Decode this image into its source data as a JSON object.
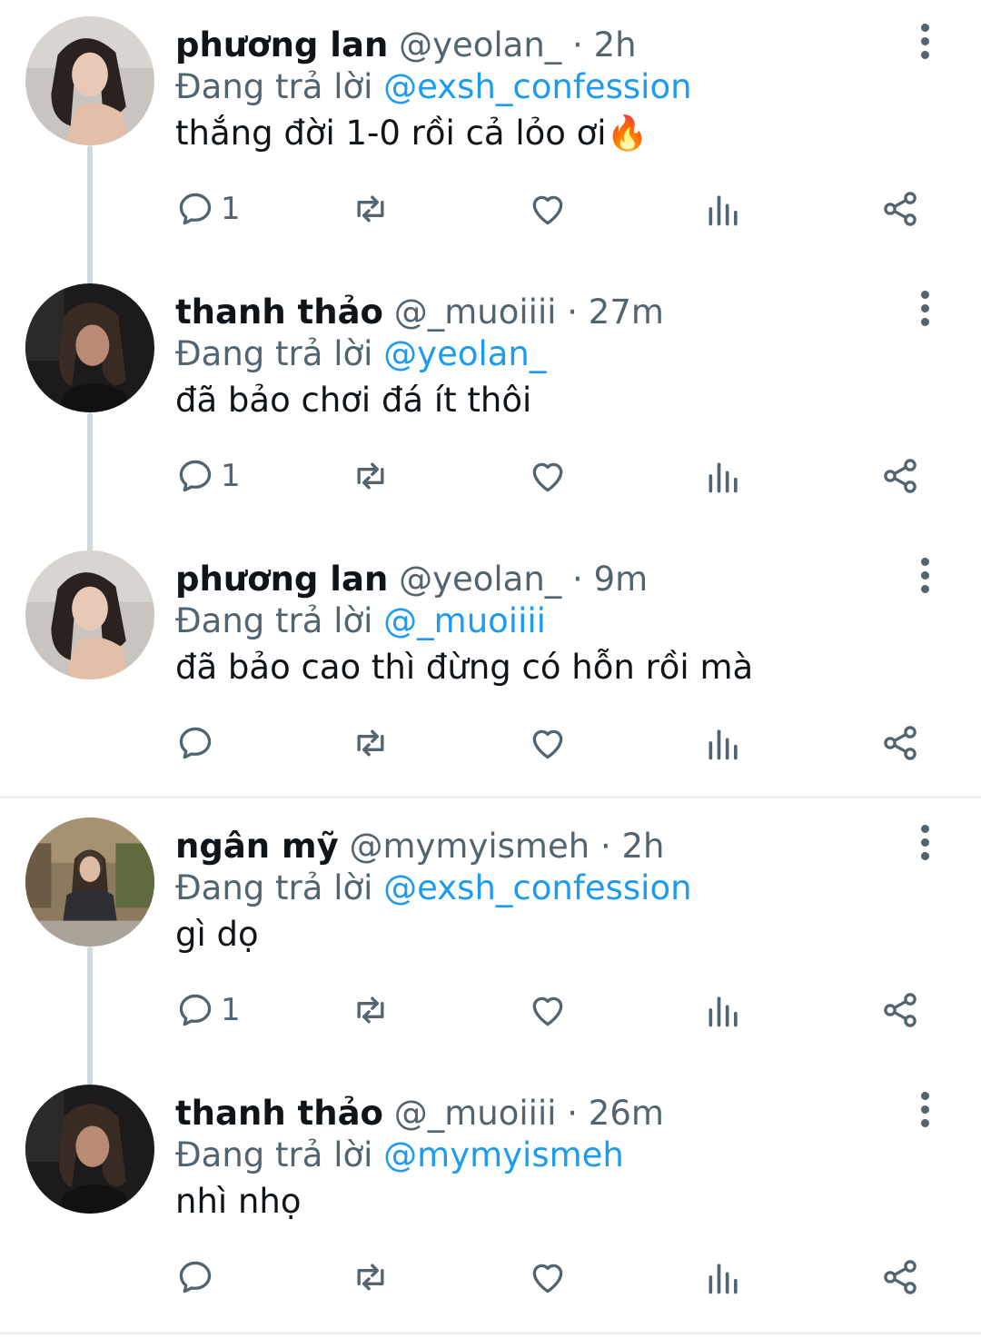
{
  "tweets": [
    {
      "name": "phương lan",
      "handle": "@yeolan_",
      "dot": "·",
      "time": "2h",
      "reply_prefix": "Đang trả lời",
      "reply_to": "@exsh_confession",
      "text": "thắng đời 1-0 rồi cả lỏo ơi🔥",
      "reply_count": "1"
    },
    {
      "name": "thanh thảo",
      "handle": "@_muoiiii",
      "dot": "·",
      "time": "27m",
      "reply_prefix": "Đang trả lời",
      "reply_to": "@yeolan_",
      "text": "đã bảo chơi đá ít thôi",
      "reply_count": "1"
    },
    {
      "name": "phương lan",
      "handle": "@yeolan_",
      "dot": "·",
      "time": "9m",
      "reply_prefix": "Đang trả lời",
      "reply_to": "@_muoiiii",
      "text": "đã bảo cao thì đừng có hỗn rồi mà",
      "reply_count": ""
    },
    {
      "name": "ngân mỹ",
      "handle": "@mymyismeh",
      "dot": "·",
      "time": "2h",
      "reply_prefix": "Đang trả lời",
      "reply_to": "@exsh_confession",
      "text": "gì dọ",
      "reply_count": "1"
    },
    {
      "name": "thanh thảo",
      "handle": "@_muoiiii",
      "dot": "·",
      "time": "26m",
      "reply_prefix": "Đang trả lời",
      "reply_to": "@mymyismeh",
      "text": "nhì nhọ",
      "reply_count": ""
    }
  ],
  "icons": {
    "reply": "reply-icon",
    "retweet": "retweet-icon",
    "like": "heart-icon",
    "views": "analytics-icon",
    "share": "share-icon",
    "more": "more-vertical-icon"
  },
  "colors": {
    "text": "#0f1419",
    "secondary": "#536471",
    "mention": "#1d9bf0",
    "thread_line": "#cfd9de",
    "separator": "#eff3f4"
  }
}
